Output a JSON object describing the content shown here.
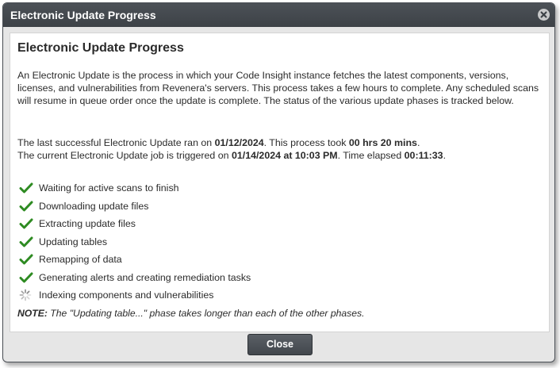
{
  "dialog": {
    "title": "Electronic Update Progress",
    "heading": "Electronic Update Progress",
    "description": "An Electronic Update is the process in which your Code Insight instance fetches the latest components, versions, licenses, and vulnerabilities from Revenera's servers. This process takes a few hours to complete. Any scheduled scans will resume in queue order once the update is complete. The status of the various update phases is tracked below.",
    "last_run": {
      "prefix": "The last successful Electronic Update ran on ",
      "date": "01/12/2024",
      "mid": ". This process took ",
      "duration": "00 hrs 20 mins",
      "suffix": "."
    },
    "current_run": {
      "prefix": "The current Electronic Update job is triggered on ",
      "datetime": "01/14/2024 at 10:03 PM",
      "mid": ". Time elapsed ",
      "elapsed": "00:11:33",
      "suffix": "."
    },
    "phases": [
      {
        "label": "Waiting for active scans to finish",
        "status": "complete",
        "icon": "check-icon"
      },
      {
        "label": "Downloading update files",
        "status": "complete",
        "icon": "check-icon"
      },
      {
        "label": "Extracting update files",
        "status": "complete",
        "icon": "check-icon"
      },
      {
        "label": "Updating tables",
        "status": "complete",
        "icon": "check-icon"
      },
      {
        "label": "Remapping of data",
        "status": "complete",
        "icon": "check-icon"
      },
      {
        "label": "Generating alerts and creating remediation tasks",
        "status": "complete",
        "icon": "check-icon"
      },
      {
        "label": "Indexing components and vulnerabilities",
        "status": "in-progress",
        "icon": "spinner-icon"
      }
    ],
    "note": {
      "prefix": "NOTE:",
      "text": " The \"Updating table...\" phase takes longer than each of the other phases."
    },
    "close_label": "Close"
  },
  "colors": {
    "titlebar": "#42474d",
    "check": "#2e8b22",
    "spinner": "#8c8c8c"
  }
}
